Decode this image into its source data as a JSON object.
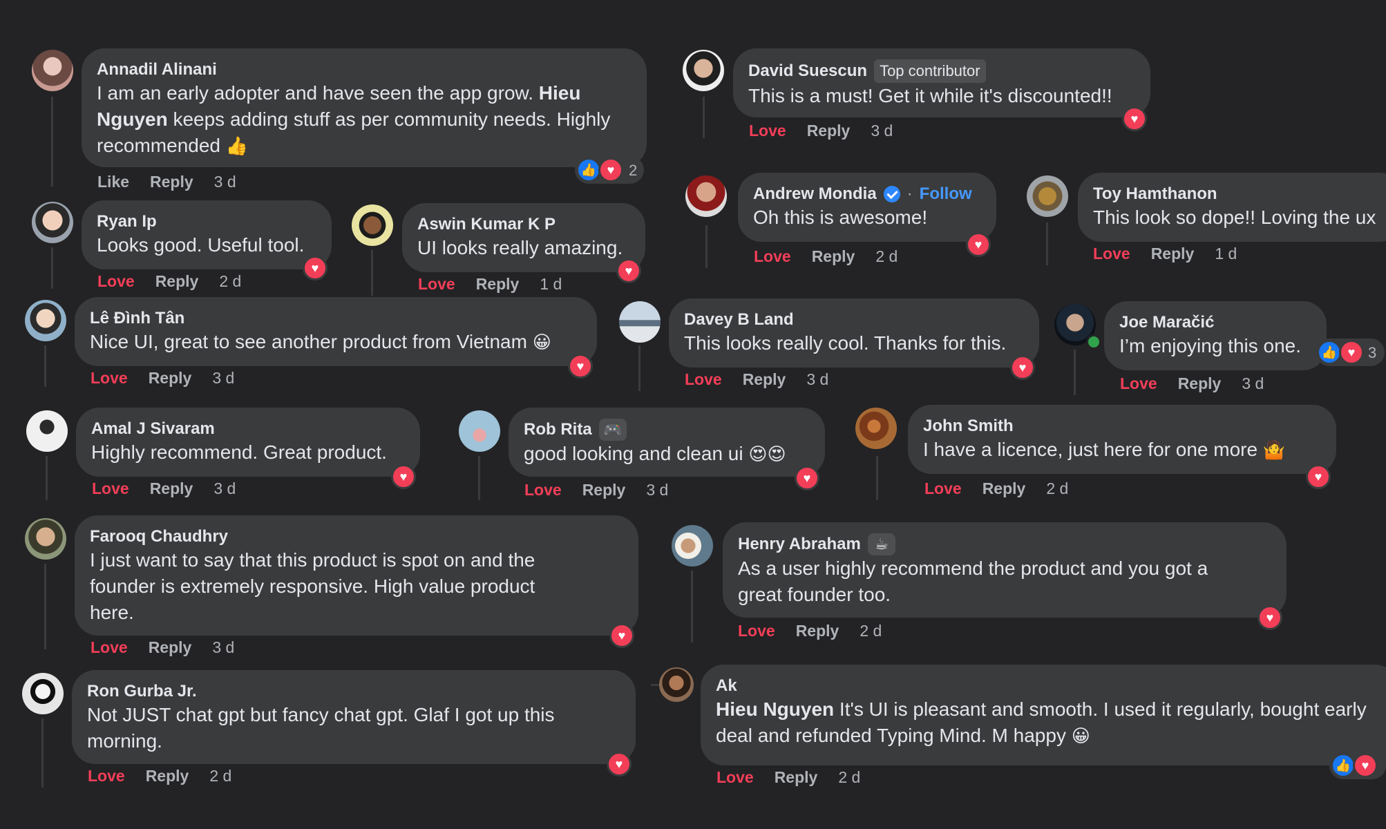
{
  "comments": [
    {
      "author": "Annadil Alinani",
      "text_a": "I am an early adopter and have seen the app grow. ",
      "mention": "Hieu Nguyen",
      "text_b": " keeps adding stuff as per community needs. Highly recommended ",
      "emoji": "👍",
      "actions": {
        "love": "Like",
        "reply": "Reply",
        "time": "3 d"
      },
      "reaction_count": "2"
    },
    {
      "author": "David Suescun",
      "badge": "Top contributor",
      "text": "This is a must! Get it while it's discounted!!",
      "actions": {
        "love": "Love",
        "reply": "Reply",
        "time": "3 d"
      }
    },
    {
      "author": "Ryan Ip",
      "text": "Looks good. Useful tool.",
      "actions": {
        "love": "Love",
        "reply": "Reply",
        "time": "2 d"
      }
    },
    {
      "author": "Aswin Kumar K P",
      "text": "UI looks really amazing.",
      "actions": {
        "love": "Love",
        "reply": "Reply",
        "time": "1 d"
      }
    },
    {
      "author": "Andrew Mondia",
      "follow": "Follow",
      "sep": "·",
      "text": "Oh this is awesome!",
      "actions": {
        "love": "Love",
        "reply": "Reply",
        "time": "2 d"
      }
    },
    {
      "author": "Toy Hamthanon",
      "text": "This look so dope!! Loving the ux",
      "actions": {
        "love": "Love",
        "reply": "Reply",
        "time": "1 d"
      }
    },
    {
      "author": "Lê Đình Tân",
      "text": "Nice UI, great to see another product from Vietnam ",
      "emoji": "😀",
      "actions": {
        "love": "Love",
        "reply": "Reply",
        "time": "3 d"
      }
    },
    {
      "author": "Davey B Land",
      "text": "This looks really cool. Thanks for this.",
      "actions": {
        "love": "Love",
        "reply": "Reply",
        "time": "3 d"
      }
    },
    {
      "author": "Joe Maračić",
      "text": "I’m enjoying this one.",
      "actions": {
        "love": "Love",
        "reply": "Reply",
        "time": "3 d"
      },
      "reaction_count": "3"
    },
    {
      "author": "Amal J Sivaram",
      "text": "Highly recommend. Great product.",
      "actions": {
        "love": "Love",
        "reply": "Reply",
        "time": "3 d"
      }
    },
    {
      "author": "Rob Rita",
      "text": "good looking and clean ui ",
      "emoji": "😍😍",
      "actions": {
        "love": "Love",
        "reply": "Reply",
        "time": "3 d"
      }
    },
    {
      "author": "John Smith",
      "text": "I have a licence, just here for one more ",
      "emoji": "🤷",
      "actions": {
        "love": "Love",
        "reply": "Reply",
        "time": "2 d"
      }
    },
    {
      "author": "Farooq Chaudhry",
      "text": "I just want to say that this product is spot on and the founder is extremely responsive. High value product here.",
      "actions": {
        "love": "Love",
        "reply": "Reply",
        "time": "3 d"
      }
    },
    {
      "author": "Henry Abraham",
      "text": "As a user highly recommend the product and you got a great founder too.",
      "actions": {
        "love": "Love",
        "reply": "Reply",
        "time": "2 d"
      }
    },
    {
      "author": "Ron Gurba Jr.",
      "text": "Not JUST chat gpt but fancy chat gpt. Glaf I got up this morning.",
      "actions": {
        "love": "Love",
        "reply": "Reply",
        "time": "2 d"
      }
    },
    {
      "author": "Ak",
      "mention": "Hieu Nguyen",
      "text_b": " It's UI is pleasant and smooth. I used it regularly, bought early deal and refunded Typing Mind. M happy ",
      "emoji": "😀",
      "actions": {
        "love": "Love",
        "reply": "Reply",
        "time": "2 d"
      }
    }
  ],
  "colors": {
    "background": "#232325",
    "bubble": "#3a3b3c",
    "love": "#f33e58",
    "like": "#1877f2",
    "link": "#4599ff"
  }
}
